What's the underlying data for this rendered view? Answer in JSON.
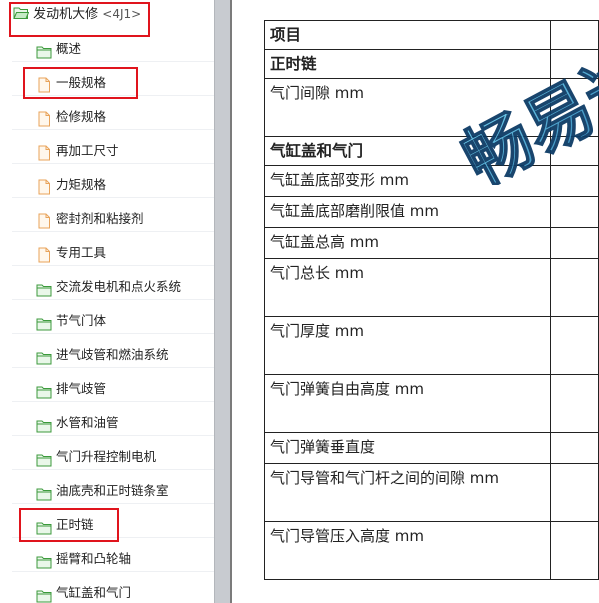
{
  "tree": {
    "root": {
      "label": "发动机大修",
      "code": "<4J1>"
    },
    "items": [
      {
        "label": "概述",
        "type": "folder"
      },
      {
        "label": "一般规格",
        "type": "doc"
      },
      {
        "label": "检修规格",
        "type": "doc"
      },
      {
        "label": "再加工尺寸",
        "type": "doc"
      },
      {
        "label": "力矩规格",
        "type": "doc"
      },
      {
        "label": "密封剂和粘接剂",
        "type": "doc"
      },
      {
        "label": "专用工具",
        "type": "doc"
      },
      {
        "label": "交流发电机和点火系统",
        "type": "folder"
      },
      {
        "label": "节气门体",
        "type": "folder"
      },
      {
        "label": "进气歧管和燃油系统",
        "type": "folder"
      },
      {
        "label": "排气歧管",
        "type": "folder"
      },
      {
        "label": "水管和油管",
        "type": "folder"
      },
      {
        "label": "气门升程控制电机",
        "type": "folder"
      },
      {
        "label": "油底壳和正时链条室",
        "type": "folder"
      },
      {
        "label": "正时链",
        "type": "folder"
      },
      {
        "label": "摇臂和凸轮轴",
        "type": "folder"
      },
      {
        "label": "气缸盖和气门",
        "type": "folder"
      }
    ]
  },
  "table": {
    "rows": [
      {
        "label": "项目",
        "header": true
      },
      {
        "label": "正时链",
        "header": true
      },
      {
        "label": "气门间隙 mm",
        "header": false,
        "tall": true
      },
      {
        "label": "气缸盖和气门",
        "header": true
      },
      {
        "label": "气缸盖底部变形 mm",
        "header": false
      },
      {
        "label": "气缸盖底部磨削限值 mm",
        "header": false
      },
      {
        "label": "气缸盖总高 mm",
        "header": false
      },
      {
        "label": "气门总长 mm",
        "header": false,
        "tall": true
      },
      {
        "label": "气门厚度 mm",
        "header": false,
        "tall": true
      },
      {
        "label": "气门弹簧自由高度 mm",
        "header": false,
        "tall": true
      },
      {
        "label": "气门弹簧垂直度",
        "header": false
      },
      {
        "label": "气门导管和气门杆之间的间隙 mm",
        "header": false,
        "tall": true
      },
      {
        "label": "气门导管压入高度 mm",
        "header": false,
        "tall": true
      }
    ]
  },
  "watermark": {
    "text": "畅易达"
  },
  "colors": {
    "highlight": "#e0141d",
    "folder": "#4caf50",
    "doc": "#f3b36b"
  }
}
